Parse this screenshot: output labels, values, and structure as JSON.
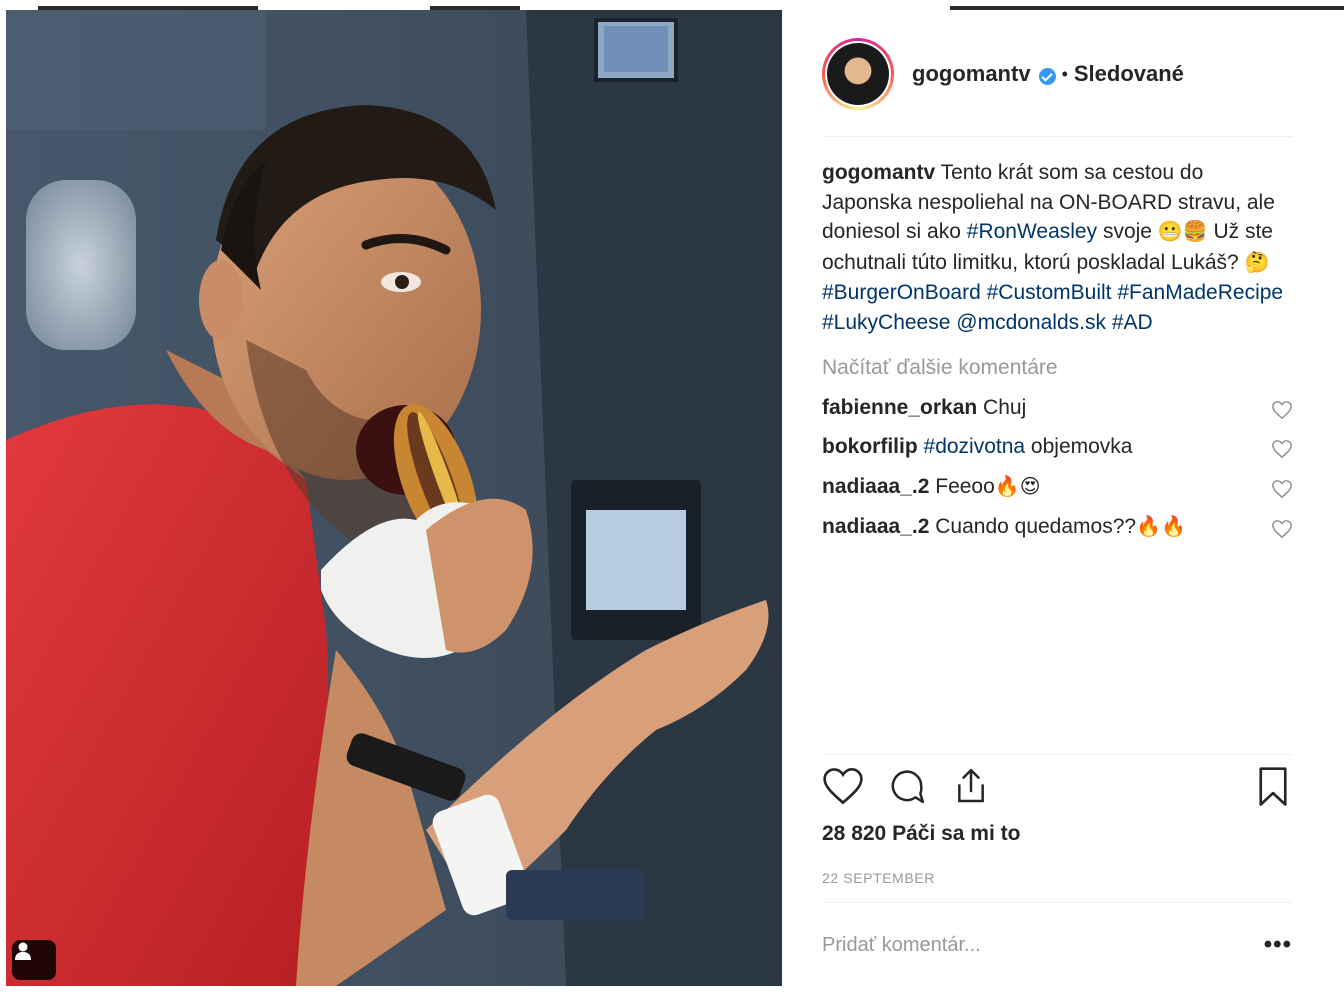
{
  "post": {
    "author": {
      "username": "gogomantv",
      "verified": true,
      "follow_state": "Sledované",
      "separator": "•"
    },
    "caption": {
      "username": "gogomantv",
      "text_1": " Tento krát som sa cestou do Japonska nespoliehal na ON-BOARD stravu, ale doniesol si ako ",
      "tag_1": "#RonWeasley",
      "text_2": " svoje ",
      "emoji_1": "😬🍔",
      "text_3": " Už ste ochutnali túto limitku, ktorú poskladal Lukáš? ",
      "emoji_2": "🤔",
      "tag_2": "#BurgerOnBoard",
      "tag_3": "#CustomBuilt",
      "tag_4": "#FanMadeRecipe",
      "tag_5": "#LukyCheese",
      "mention": "@mcdonalds.sk",
      "tag_6": "#AD"
    },
    "load_more": "Načítať ďalšie komentáre",
    "comments": [
      {
        "username": "fabienne_orkan",
        "pre": " Chuj",
        "tag": "",
        "post": "",
        "emoji": ""
      },
      {
        "username": "bokorfilip",
        "pre": " ",
        "tag": "#dozivotna",
        "post": " objemovka",
        "emoji": ""
      },
      {
        "username": "nadiaaa_.2",
        "pre": " Feeoo",
        "tag": "",
        "post": "",
        "emoji": "🔥😍"
      },
      {
        "username": "nadiaaa_.2",
        "pre": " Cuando quedamos??",
        "tag": "",
        "post": "",
        "emoji": "🔥🔥"
      }
    ],
    "likes_count": "28 820",
    "likes_label": "Páči sa mi to",
    "date": "22 SEPTEMBER",
    "add_comment_placeholder": "Pridať komentár...",
    "more_options": "•••"
  },
  "icons": {
    "like": "heart-icon",
    "comment": "comment-bubble-icon",
    "share": "share-icon",
    "save": "bookmark-icon",
    "tagged_users": "user-tag-icon"
  },
  "colors": {
    "text": "#262626",
    "hashtag": "#003569",
    "muted": "#999999",
    "verified": "#3897f0",
    "shirt": "#d8262b"
  }
}
